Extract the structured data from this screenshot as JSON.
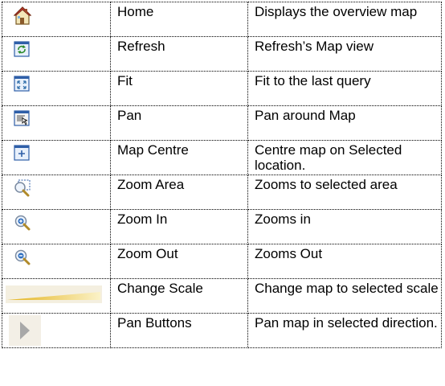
{
  "rows": [
    {
      "icon": "home-icon",
      "name": "Home",
      "description": "Displays the overview map"
    },
    {
      "icon": "refresh-icon",
      "name": "Refresh",
      "description": "Refresh’s Map view"
    },
    {
      "icon": "fit-icon",
      "name": "Fit",
      "description": "Fit to the last query"
    },
    {
      "icon": "pan-icon",
      "name": "Pan",
      "description": "Pan around Map"
    },
    {
      "icon": "map-centre-icon",
      "name": "Map Centre",
      "description": "Centre map on Selected location."
    },
    {
      "icon": "zoom-area-icon",
      "name": "Zoom Area",
      "description": "Zooms to selected area"
    },
    {
      "icon": "zoom-in-icon",
      "name": "Zoom In",
      "description": "Zooms in"
    },
    {
      "icon": "zoom-out-icon",
      "name": "Zoom Out",
      "description": "Zooms Out"
    },
    {
      "icon": "change-scale-icon",
      "name": "Change Scale",
      "description": "Change map to selected scale"
    },
    {
      "icon": "pan-buttons-icon",
      "name": "Pan Buttons",
      "description": "Pan map in selected direction."
    }
  ]
}
